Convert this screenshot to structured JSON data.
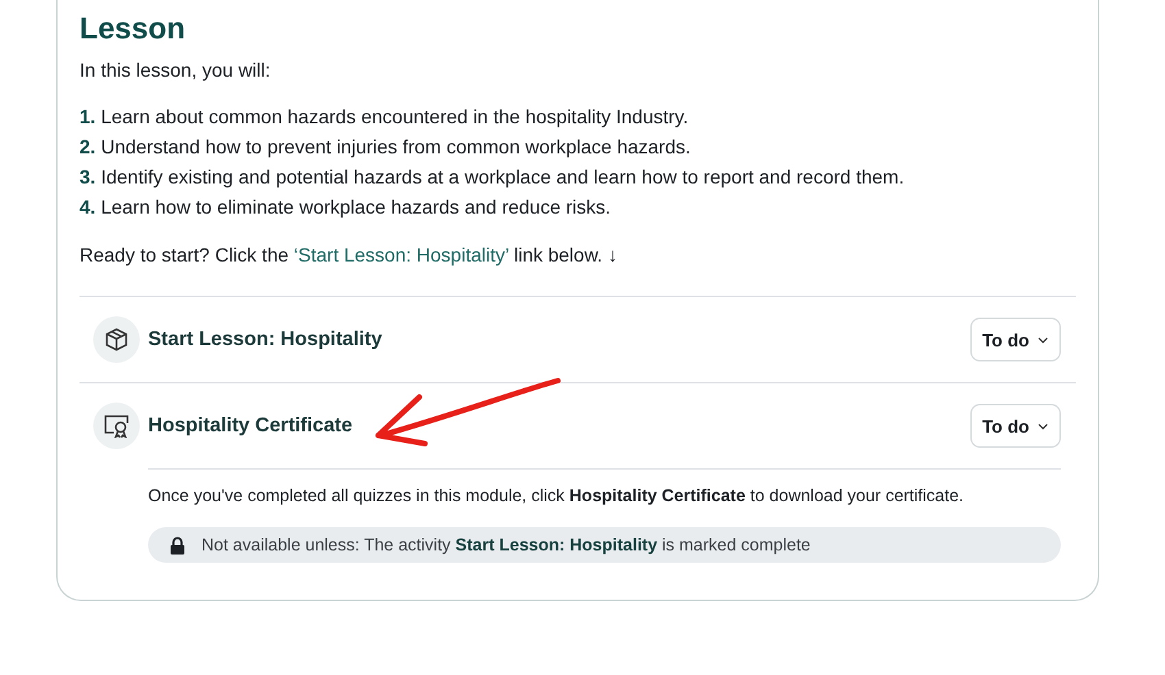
{
  "section": {
    "title": "Lesson",
    "intro": "In this lesson, you will:",
    "objectives": [
      "**1.** Learn about common hazards encountered in the hospitality Industry.",
      "**2.** Understand how to prevent injuries from common workplace hazards.",
      "**3.** Identify existing and potential hazards at a workplace and learn how to report and record them.",
      "**4.** Learn how to eliminate workplace hazards and reduce risks."
    ],
    "prompt": {
      "before": "Ready to start? Click the ",
      "link": "‘Start Lesson: Hospitality’",
      "after": " link below. ↓"
    }
  },
  "activities": [
    {
      "kind": "page",
      "name": "Start Lesson: Hospitality",
      "status": "To do"
    },
    {
      "kind": "certificate",
      "name": "Hospitality Certificate",
      "status": "To do",
      "description": "Once you've completed all quizzes in this module, click **Hospitality Certificate** to download your certificate.",
      "restriction": "Not available unless: The activity **Start Lesson: Hospitality** is marked complete"
    }
  ]
}
